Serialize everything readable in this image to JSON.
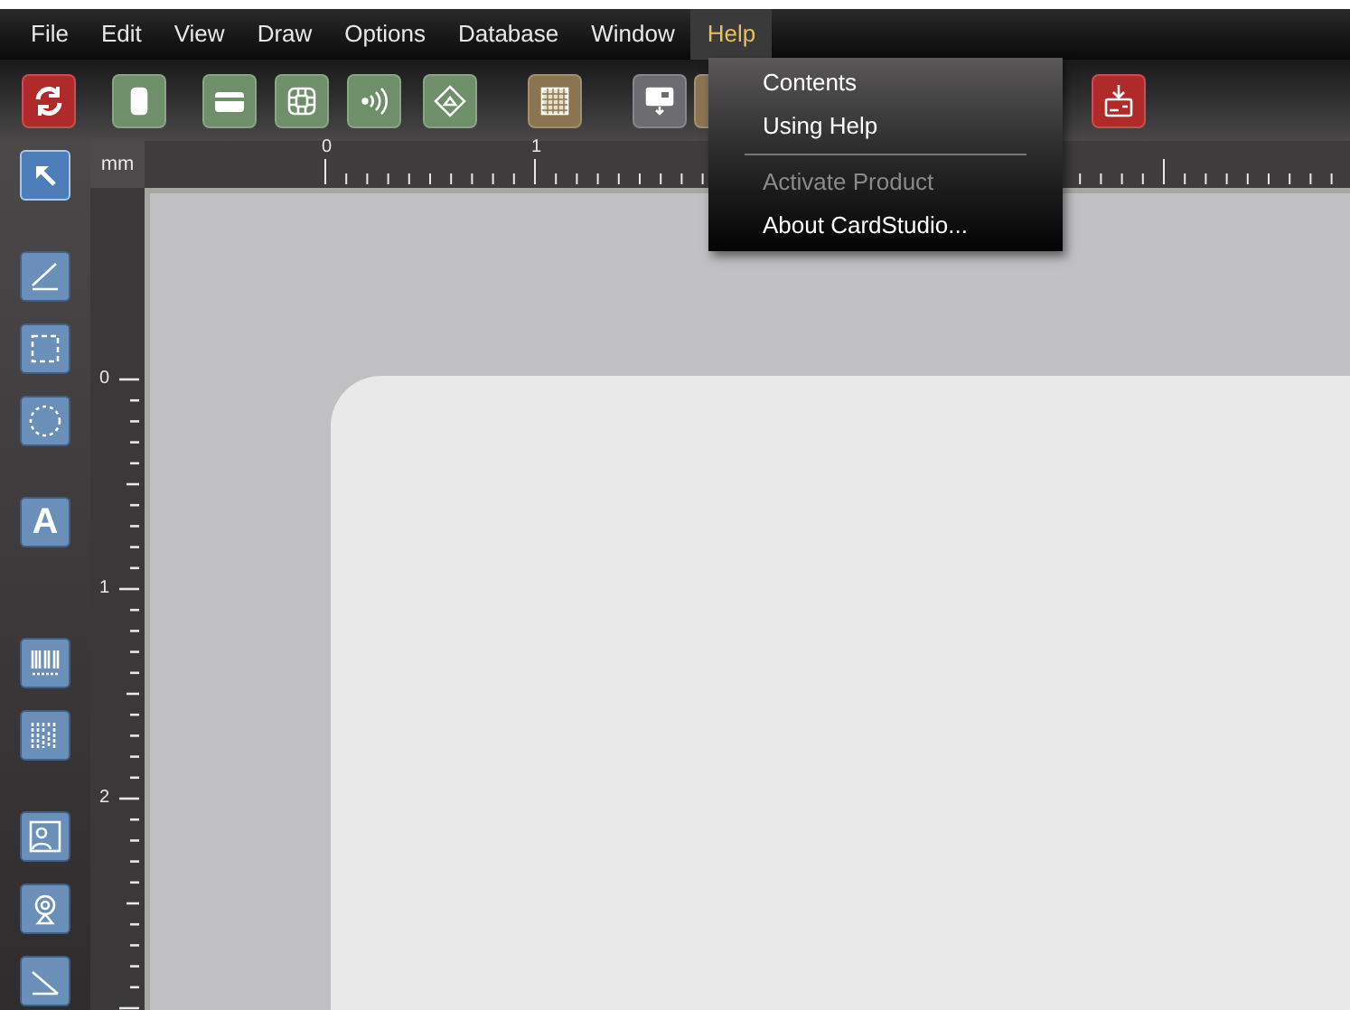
{
  "menu_bar": [
    {
      "label": "File",
      "selected": false
    },
    {
      "label": "Edit",
      "selected": false
    },
    {
      "label": "View",
      "selected": false
    },
    {
      "label": "Draw",
      "selected": false
    },
    {
      "label": "Options",
      "selected": false
    },
    {
      "label": "Database",
      "selected": false
    },
    {
      "label": "Window",
      "selected": false
    },
    {
      "label": "Help",
      "selected": true
    }
  ],
  "toolbar": [
    {
      "kind": "refresh",
      "color": "#b02a2a"
    },
    {
      "kind": "ribbon",
      "color": "#6f8f6a"
    },
    {
      "kind": "card",
      "color": "#6f8f6a"
    },
    {
      "kind": "chip",
      "color": "#6f8f6a"
    },
    {
      "kind": "contactless",
      "color": "#6f8f6a"
    },
    {
      "kind": "magstripe",
      "color": "#6f8f6a"
    },
    {
      "kind": "grid",
      "color": "#8a7550"
    },
    {
      "kind": "print",
      "color": "#6b6b70"
    },
    {
      "kind": "blank",
      "color": "#8a7550"
    },
    {
      "kind": "download",
      "color": "#b02a2a"
    }
  ],
  "help_menu": [
    {
      "label": "Contents",
      "disabled": false
    },
    {
      "label": "Using Help",
      "disabled": false
    },
    {
      "kind": "separator"
    },
    {
      "label": "Activate Product",
      "disabled": true
    },
    {
      "label": "About CardStudio...",
      "disabled": false
    }
  ],
  "unit": "mm",
  "horizontal_ruler": {
    "labels": [
      "0",
      "1"
    ]
  },
  "vertical_ruler": {
    "labels": [
      "0",
      "1",
      "2"
    ]
  },
  "tools": [
    {
      "kind": "pointer",
      "selected": true
    },
    {
      "kind": "line",
      "selected": false
    },
    {
      "kind": "rectangle",
      "selected": false
    },
    {
      "kind": "ellipse",
      "selected": false
    },
    {
      "kind": "text",
      "label": "A",
      "selected": false
    },
    {
      "kind": "barcode",
      "selected": false
    },
    {
      "kind": "barcode2d",
      "selected": false
    },
    {
      "kind": "image",
      "selected": false
    },
    {
      "kind": "webcam",
      "selected": false
    },
    {
      "kind": "signature",
      "selected": false
    }
  ]
}
